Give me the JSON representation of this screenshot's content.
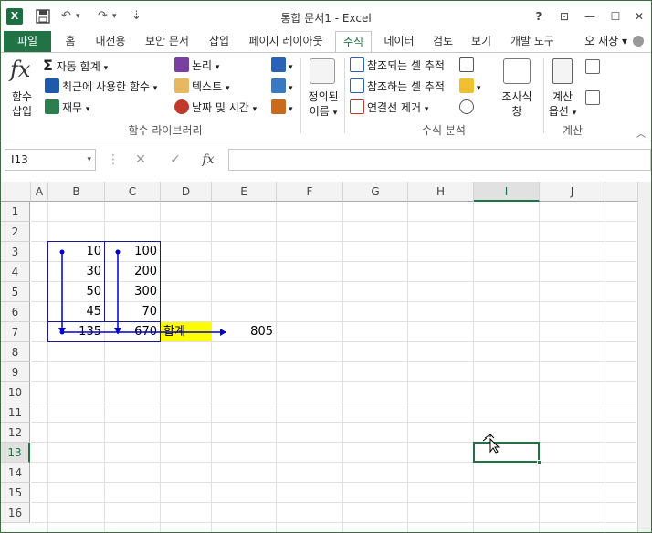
{
  "window": {
    "title": "통합 문서1 - Excel",
    "help": "?",
    "controls": {
      "restore_ribbon": "⊡",
      "minimize": "—",
      "maximize": "☐",
      "close": "✕"
    }
  },
  "qat": {
    "app_icon": "X",
    "save": "💾",
    "undo": "↶",
    "redo": "↷",
    "customize": "⇣"
  },
  "tabs": [
    "파일",
    "홈",
    "내전용",
    "보안 문서",
    "삽입",
    "페이지 레이아웃",
    "수식",
    "데이터",
    "검토",
    "보기",
    "개발 도구"
  ],
  "active_tab": "수식",
  "user": "오 재상",
  "ribbon": {
    "insert_function": {
      "glyph": "fx",
      "label1": "함수",
      "label2": "삽입"
    },
    "autosum": "자동 합계",
    "recent": "최근에 사용한 함수",
    "financial": "재무",
    "logical": "논리",
    "text": "텍스트",
    "datetime": "날짜 및 시간",
    "library_label": "함수 라이브러리",
    "defined_names": {
      "label1": "정의된",
      "label2": "이름"
    },
    "trace_precedents": "참조되는 셀 추적",
    "trace_dependents": "참조하는 셀 추적",
    "remove_arrows": "연결선 제거",
    "watch": {
      "label1": "조사식",
      "label2": "창"
    },
    "auditing_label": "수식 분석",
    "calc_options": {
      "label1": "계산",
      "label2": "옵션"
    },
    "calc_label": "계산"
  },
  "formula_bar": {
    "name_box": "I13",
    "cancel": "✕",
    "enter": "✓",
    "fx": "fx",
    "value": ""
  },
  "columns": [
    "A",
    "B",
    "C",
    "D",
    "E",
    "F",
    "G",
    "H",
    "I",
    "J"
  ],
  "rows": [
    "1",
    "2",
    "3",
    "4",
    "5",
    "6",
    "7",
    "8",
    "9",
    "10",
    "11",
    "12",
    "13",
    "14",
    "15",
    "16"
  ],
  "selected_cell": "I13",
  "cells": {
    "B3": "10",
    "C3": "100",
    "B4": "30",
    "C4": "200",
    "B5": "50",
    "C5": "300",
    "B6": "45",
    "C6": "70",
    "B7": "135",
    "C7": "670",
    "D7": "합계",
    "E7": "805"
  },
  "colors": {
    "accent": "#217346",
    "highlight": "#ffff00",
    "trace_arrow": "#0000cc"
  }
}
